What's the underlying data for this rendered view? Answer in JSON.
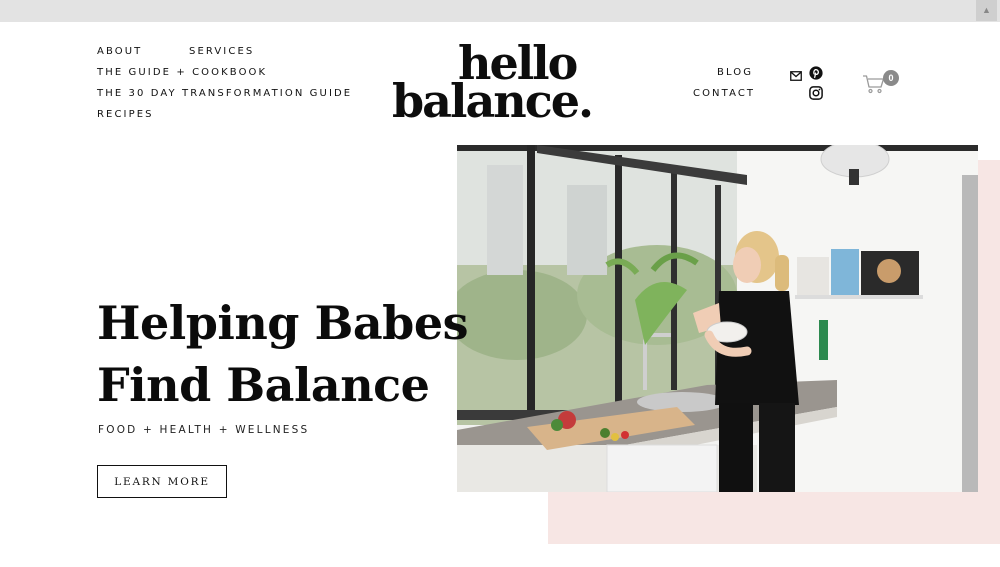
{
  "window": {
    "scroll_button_glyph": "▲"
  },
  "nav": {
    "left": [
      {
        "id": "about",
        "label": "ABOUT"
      },
      {
        "id": "services",
        "label": "SERVICES"
      },
      {
        "id": "guide-cookbook",
        "label": "THE GUIDE + COOKBOOK"
      },
      {
        "id": "transformation",
        "label": "THE 30 DAY TRANSFORMATION GUIDE"
      },
      {
        "id": "recipes",
        "label": "RECIPES"
      }
    ],
    "right": [
      {
        "id": "blog",
        "label": "BLOG"
      },
      {
        "id": "contact",
        "label": "CONTACT"
      }
    ]
  },
  "logo": {
    "line1": "hello",
    "line2": "balance."
  },
  "social_icons": [
    "mail-icon",
    "pinterest-icon",
    "instagram-icon"
  ],
  "cart": {
    "icon": "cart-icon",
    "count": "0"
  },
  "hero": {
    "title_line1": "Helping Babes",
    "title_line2": "Find Balance",
    "subtitle": "FOOD + HEALTH + WELLNESS",
    "cta_label": "LEARN MORE",
    "image": "woman-eating-in-kitchen-photo"
  },
  "colors": {
    "accent_pink": "#f7e6e4",
    "text": "#111111",
    "cart_badge": "#8a8a8a"
  }
}
